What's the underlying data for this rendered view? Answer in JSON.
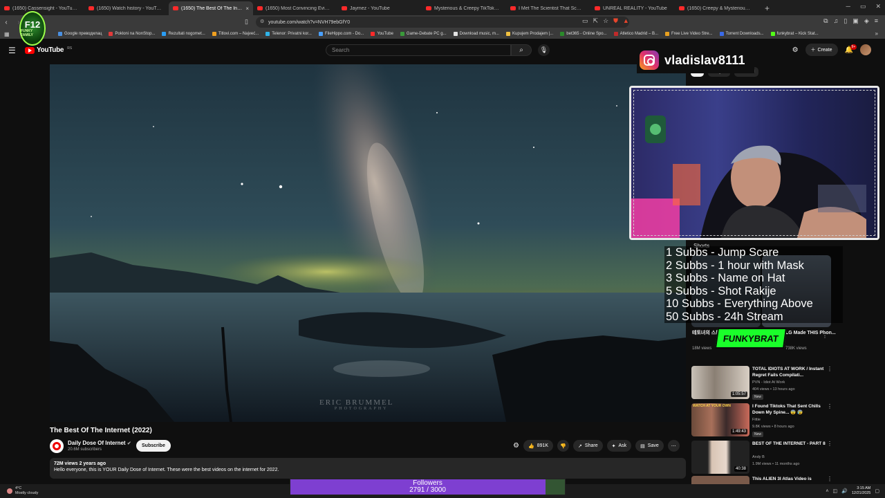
{
  "browser": {
    "tabs": [
      {
        "label": "(1650) Cassensight - YouTube",
        "active": false
      },
      {
        "label": "(1650) Watch history - YouTube",
        "active": false
      },
      {
        "label": "(1650) The Best Of The Interne",
        "active": true
      },
      {
        "label": "(1650) Most Convincing Evidence Of",
        "active": false
      },
      {
        "label": "Jaymez - YouTube",
        "active": false
      },
      {
        "label": "Mysterious & Creepy TikToks That'll",
        "active": false
      },
      {
        "label": "I Met The Scientist That Scanned Bra",
        "active": false
      },
      {
        "label": "UNREAL REALITY - YouTube",
        "active": false
      },
      {
        "label": "(1650) Creepy & Mysterious Videos",
        "active": false
      }
    ],
    "new_tab": "+",
    "url": "youtube.com/watch?v=NVH79ebGfY0",
    "bookmarks": [
      "Google преводилац",
      "Pokloni na NonStop...",
      "Rezultati nogomet...",
      "Titlovi.com – Najveć...",
      "Telenor: Privatni kor...",
      "FileHippo.com - Do...",
      "YouTube",
      "Game-Debate PC g...",
      "Download music, m...",
      "Kupujem Prodajem |...",
      "bet365 - Online Spo...",
      "Atletico Madrid – B...",
      "Free Live Video Stre...",
      "Torrent Downloads...",
      "funkybrat – Kick Stat..."
    ]
  },
  "overlay": {
    "logo_big": "F12",
    "logo_small": "FUNKY FAMILY",
    "instagram_handle": "vladislav8111",
    "sub_goals": [
      "1 Subbs - Jump Scare",
      "2 Subbs - 1 hour with Mask",
      "3 Subbs - Name on Hat",
      "5 Subbs - Shot Rakije",
      "10 Subbs - Everything Above",
      "50 Subbs - 24h Stream"
    ],
    "kick_brand": "FUNKYBRAT",
    "followers_label": "Followers",
    "followers_count": "2791 / 3000",
    "followers_progress": 0.93
  },
  "youtube": {
    "logo": "YouTube",
    "region": "RS",
    "search_placeholder": "Search",
    "create_label": "Create",
    "notif_badge": "9+",
    "video": {
      "title": "The Best Of The Internet (2022)",
      "watermark_line1": "ERIC BRUMMEL",
      "watermark_line2": "PHOTOGRAPHY",
      "channel": "Daily Dose Of Internet",
      "subscribers": "20.6M subscribers",
      "subscribe_label": "Subscribe",
      "likes": "891K",
      "share_label": "Share",
      "ask_label": "Ask",
      "save_label": "Save",
      "meta": "72M views  2 years ago",
      "description": "Hello everyone, this is YOUR Daily Dose of Internet. These were the best videos on the internet for 2022."
    },
    "chips": [
      "All",
      "For you",
      "Watched"
    ],
    "shorts_label": "Shorts",
    "shorts": [
      {
        "caption": "테토녀의 스트레스 재기 방법",
        "views": "18M views"
      },
      {
        "caption": "LG Made THIS Phon...",
        "views": "738K views"
      }
    ],
    "recommendations": [
      {
        "title": "TOTAL IDIOTS AT WORK / Instant Regret Fails Compilati...",
        "channel": "PVN - Idiot At Work",
        "views": "404 views • 13 hours ago",
        "duration": "1:05:57",
        "badge": "New"
      },
      {
        "title": "I Found Tiktoks That Sent Chills Down My Spine... 😨 😰",
        "channel": "Fittie",
        "views": "9.8K views • 8 hours ago",
        "duration": "1:49:43",
        "badge": "New",
        "thumb_text": "WATCH AT YOUR OWN"
      },
      {
        "title": "BEST OF THE INTERNET - PART 8",
        "channel": "Andy B",
        "views": "1.9M views • 11 months ago",
        "duration": "40:38",
        "badge": ""
      },
      {
        "title": "This ALIEN 3I Atlas Video is",
        "channel": "",
        "views": "",
        "duration": "",
        "badge": ""
      }
    ]
  },
  "taskbar": {
    "temp": "4°C",
    "weather": "Mostly cloudy",
    "time": "3:15 AM",
    "date": "12/21/2025"
  }
}
